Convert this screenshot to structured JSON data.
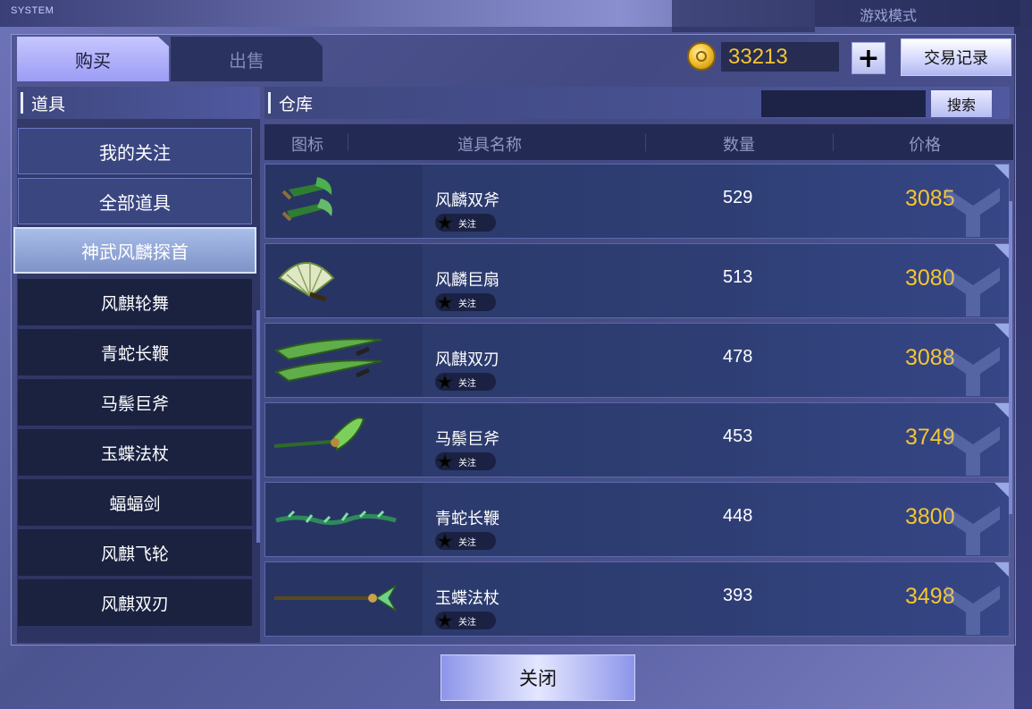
{
  "background": {
    "system_label": "SYSTEM",
    "mode_label": "游戏模式"
  },
  "tabs": {
    "buy": "购买",
    "sell": "出售"
  },
  "currency": {
    "amount": "33213",
    "plus": "+",
    "trade_record": "交易记录"
  },
  "left_panel": {
    "title": "道具",
    "top_buttons": [
      "我的关注",
      "全部道具"
    ],
    "selected_category": "神武风麟探首",
    "categories": [
      "风麒轮舞",
      "青蛇长鞭",
      "马鬃巨斧",
      "玉蝶法杖",
      "蝠蝠剑",
      "风麒飞轮",
      "风麒双刃"
    ]
  },
  "right_panel": {
    "title": "仓库",
    "search_label": "搜索",
    "columns": [
      "图标",
      "道具名称",
      "数量",
      "价格"
    ],
    "fav_label": "关注",
    "items": [
      {
        "name": "风麟双斧",
        "qty": "529",
        "price": "3085",
        "icon": "twin-axe-icon"
      },
      {
        "name": "风麟巨扇",
        "qty": "513",
        "price": "3080",
        "icon": "giant-fan-icon"
      },
      {
        "name": "风麒双刃",
        "qty": "478",
        "price": "3088",
        "icon": "twin-blade-icon"
      },
      {
        "name": "马鬃巨斧",
        "qty": "453",
        "price": "3749",
        "icon": "great-axe-icon"
      },
      {
        "name": "青蛇长鞭",
        "qty": "448",
        "price": "3800",
        "icon": "whip-icon"
      },
      {
        "name": "玉蝶法杖",
        "qty": "393",
        "price": "3498",
        "icon": "staff-icon"
      }
    ]
  },
  "close_label": "关闭",
  "colors": {
    "price": "#f5c531",
    "accent": "#9c9cf5"
  }
}
